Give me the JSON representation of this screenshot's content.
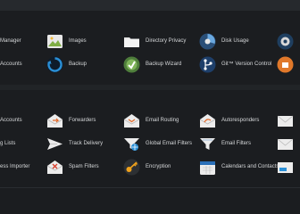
{
  "files": {
    "row1": [
      "Manager",
      "Images",
      "Directory Privacy",
      "Disk Usage"
    ],
    "row2": [
      "Accounts",
      "Backup",
      "Backup Wizard",
      "Git™ Version Control"
    ]
  },
  "email": {
    "row1": [
      "Accounts",
      "Forwarders",
      "Email Routing",
      "Autoresponders"
    ],
    "row2": [
      "g Lists",
      "Track Delivery",
      "Global Email Filters",
      "Email Filters"
    ],
    "row3": [
      "ess Importer",
      "Spam Filters",
      "Encryption",
      "Calendars and Contacts"
    ]
  }
}
